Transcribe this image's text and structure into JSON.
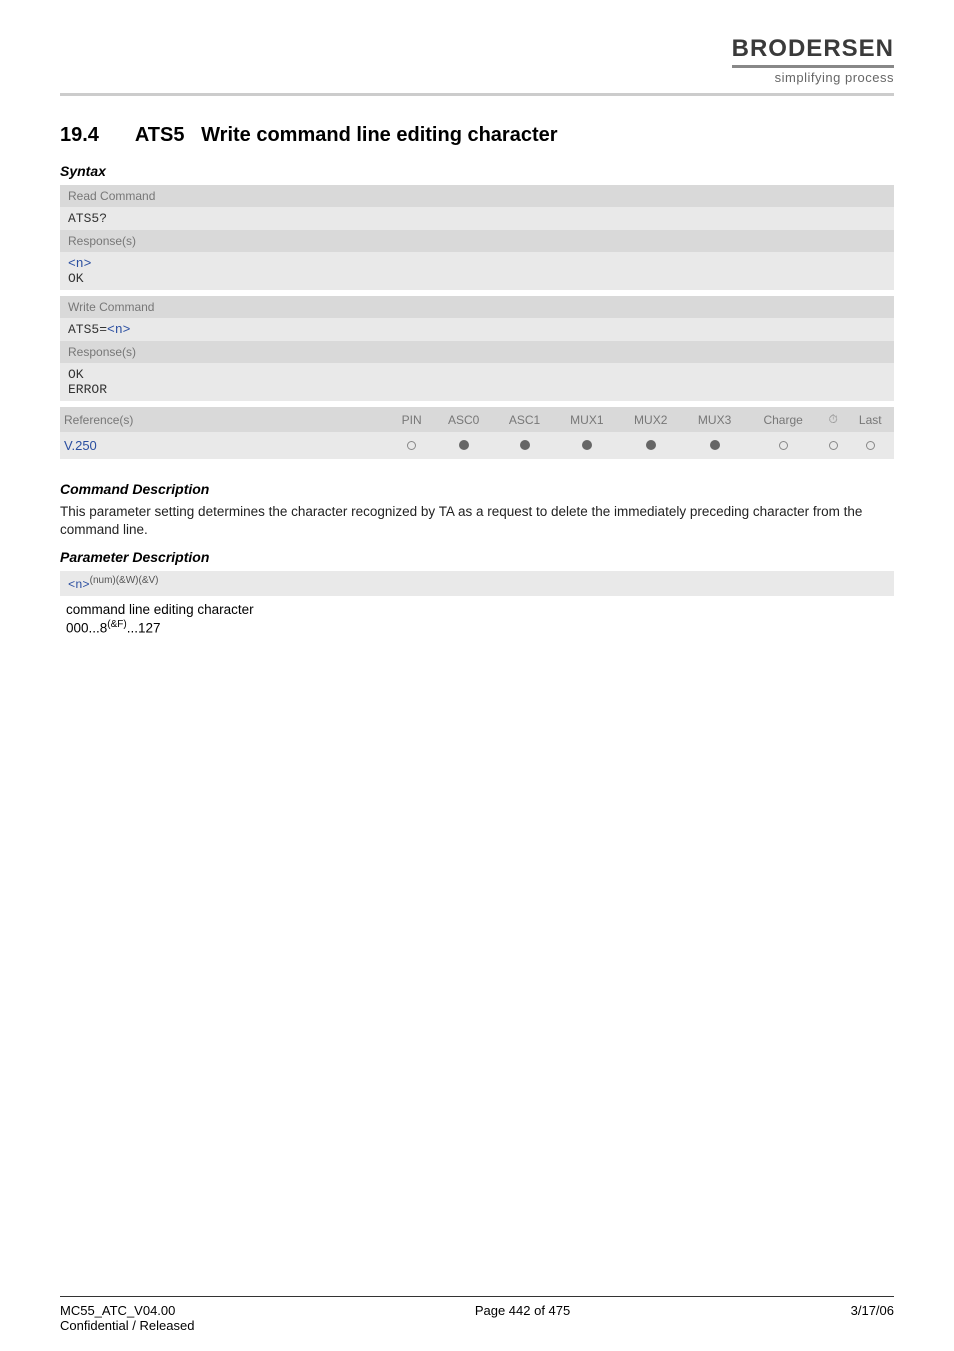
{
  "logo": {
    "name": "BRODERSEN",
    "tagline": "simplifying process"
  },
  "section": {
    "number": "19.4",
    "cmd": "ATS5",
    "title": "Write command line editing character"
  },
  "syntax_label": "Syntax",
  "read": {
    "label": "Read Command",
    "command": "ATS5?",
    "resp_label": "Response(s)",
    "resp_lines": [
      "<n>",
      "OK"
    ]
  },
  "write": {
    "label": "Write Command",
    "command_prefix": "ATS5=",
    "command_param": "<n>",
    "resp_label": "Response(s)",
    "resp_lines": [
      "OK",
      "ERROR"
    ]
  },
  "ref": {
    "label": "Reference(s)",
    "cols": [
      "PIN",
      "ASC0",
      "ASC1",
      "MUX1",
      "MUX2",
      "MUX3",
      "Charge",
      "⏱",
      "Last"
    ],
    "entry": "V.250",
    "dots": [
      "open",
      "filled",
      "filled",
      "filled",
      "filled",
      "filled",
      "open",
      "open",
      "open"
    ]
  },
  "cmd_desc": {
    "head": "Command Description",
    "text": "This parameter setting determines the character recognized by TA as a request to delete the immediately preceding character from the command line."
  },
  "param": {
    "head": "Parameter Description",
    "name": "<n>",
    "attrs": "(num)(&W)(&V)",
    "desc": "command line editing character",
    "range_a": "000...8",
    "range_sup": "(&F)",
    "range_b": "...127"
  },
  "footer": {
    "left1": "MC55_ATC_V04.00",
    "left2": "Confidential / Released",
    "center": "Page 442 of 475",
    "right": "3/17/06"
  }
}
